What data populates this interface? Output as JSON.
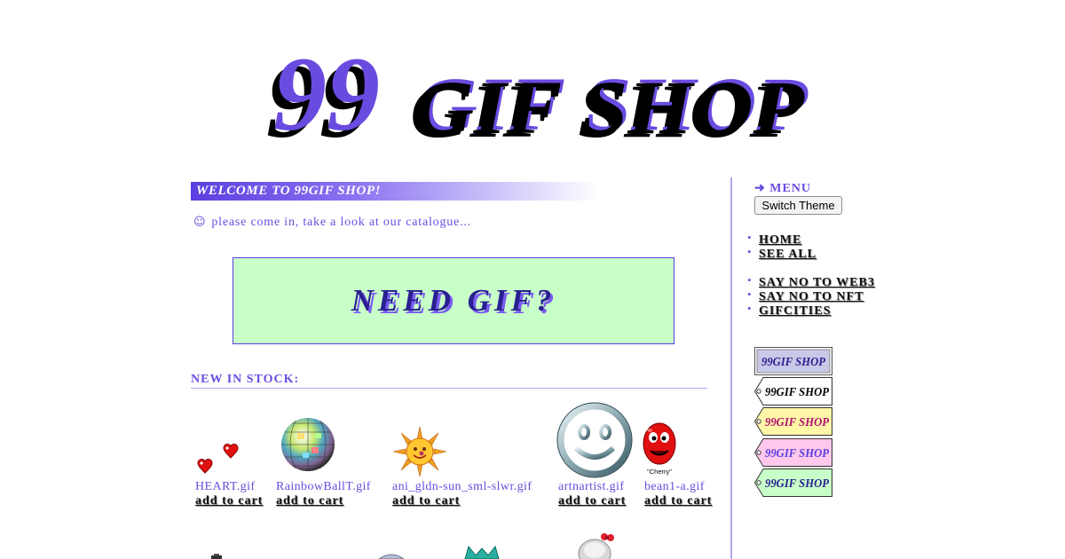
{
  "logo": {
    "number": "99",
    "words": "GIF SHOP"
  },
  "welcome": "WELCOME TO 99GIF SHOP!",
  "greeting": {
    "icon": "smiley-icon",
    "text": "please come in, take a look at our catalogue..."
  },
  "banner": "NEED GIF?",
  "new_in_stock": "NEW IN STOCK:",
  "items": [
    {
      "name": "HEART.gif",
      "cart": "add to cart",
      "icon": "hearts-icon"
    },
    {
      "name": "RainbowBallT.gif",
      "cart": "add to cart",
      "icon": "disco-ball-icon"
    },
    {
      "name": "ani_gldn-sun_sml-slwr.gif",
      "cart": "add to cart",
      "icon": "sun-icon"
    },
    {
      "name": "artnartist.gif",
      "cart": "add to cart",
      "icon": "smiley-face-icon"
    },
    {
      "name": "bean1-a.gif",
      "cart": "add to cart",
      "icon": "cherry-bean-icon",
      "caption": "\"Cherry\""
    }
  ],
  "sidebar": {
    "menu_label": "MENU",
    "menu_icon": "arrow-right-icon",
    "switch_theme": "Switch Theme",
    "nav_primary": [
      "HOME",
      "SEE ALL"
    ],
    "nav_secondary": [
      "SAY NO TO WEB3",
      "SAY NO TO NFT",
      "GIFCITIES"
    ],
    "theme_swatches": [
      {
        "label": "99GIF SHOP",
        "bg": "#c8c8e8"
      },
      {
        "label": "99GIF SHOP",
        "bg": "#ffffff"
      },
      {
        "label": "99GIF SHOP",
        "bg": "#fff6a8"
      },
      {
        "label": "99GIF SHOP",
        "bg": "#ffc8ec"
      },
      {
        "label": "99GIF SHOP",
        "bg": "#c8ffc8"
      }
    ]
  },
  "colors": {
    "accent": "#6a4be0",
    "dark": "#2a1f90",
    "banner_bg": "#c8ffc8"
  }
}
